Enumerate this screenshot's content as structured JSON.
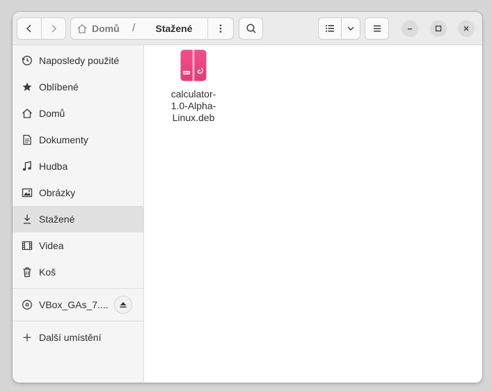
{
  "breadcrumb": {
    "home": "Domů",
    "separator": "/",
    "current": "Stažené"
  },
  "sidebar": {
    "items": [
      {
        "label": "Naposledy použité",
        "icon": "clock-icon"
      },
      {
        "label": "Oblíbené",
        "icon": "star-icon"
      },
      {
        "label": "Domů",
        "icon": "home-icon"
      },
      {
        "label": "Dokumenty",
        "icon": "document-icon"
      },
      {
        "label": "Hudba",
        "icon": "music-icon"
      },
      {
        "label": "Obrázky",
        "icon": "picture-icon"
      },
      {
        "label": "Stažené",
        "icon": "download-icon",
        "active": true
      },
      {
        "label": "Videa",
        "icon": "film-icon"
      },
      {
        "label": "Koš",
        "icon": "trash-icon"
      }
    ],
    "device": {
      "label": "VBox_GAs_7....",
      "icon": "disc-icon",
      "action_icon": "eject-icon"
    },
    "other_locations": {
      "label": "Další umístění",
      "icon": "plus-icon"
    }
  },
  "files": [
    {
      "name_lines": [
        "calculator-",
        "1.0-Alpha-",
        "Linux.deb"
      ],
      "icon": "deb-package-icon",
      "icon_color": "#e8457e"
    }
  ],
  "colors": {
    "active_item": "#e1e1e1",
    "sidebar_bg": "#f5f5f5",
    "headerbar_bg": "#ebebeb"
  }
}
